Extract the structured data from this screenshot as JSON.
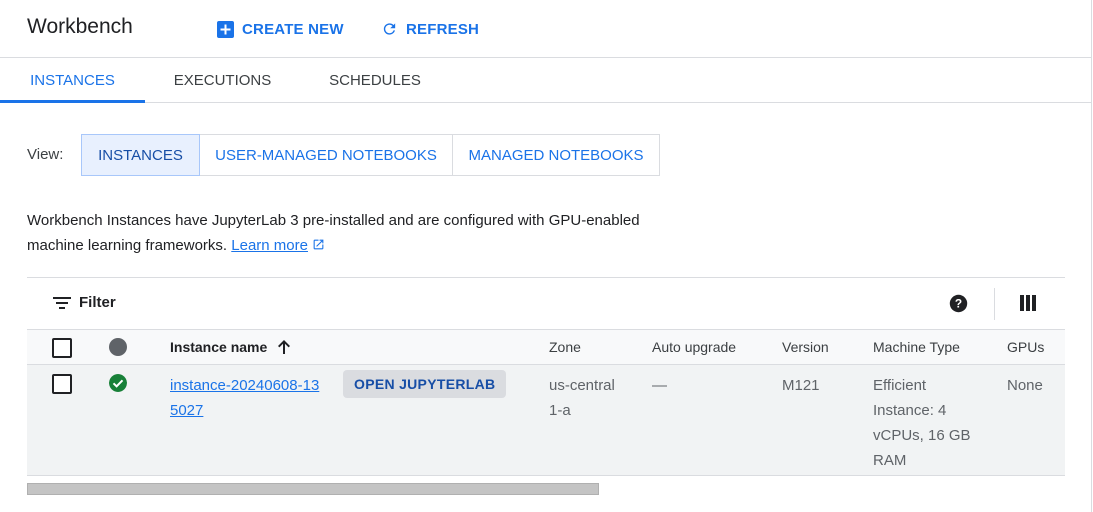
{
  "header": {
    "title": "Workbench",
    "create_label": "CREATE NEW",
    "refresh_label": "REFRESH"
  },
  "tabs": [
    {
      "label": "INSTANCES",
      "active": true
    },
    {
      "label": "EXECUTIONS",
      "active": false
    },
    {
      "label": "SCHEDULES",
      "active": false
    }
  ],
  "view": {
    "label": "View:",
    "options": [
      {
        "label": "INSTANCES",
        "selected": true
      },
      {
        "label": "USER-MANAGED NOTEBOOKS",
        "selected": false
      },
      {
        "label": "MANAGED NOTEBOOKS",
        "selected": false
      }
    ]
  },
  "description": {
    "text": "Workbench Instances have JupyterLab 3 pre-installed and are configured with GPU-enabled machine learning frameworks.",
    "link": "Learn more"
  },
  "toolbar": {
    "filter_label": "Filter",
    "icons": [
      "filter-icon",
      "help-icon",
      "column-display-icon"
    ]
  },
  "table": {
    "columns": {
      "name": "Instance name",
      "zone": "Zone",
      "auto_upgrade": "Auto upgrade",
      "version": "Version",
      "machine_type": "Machine Type",
      "gpus": "GPUs"
    },
    "rows": [
      {
        "name": "instance-20240608-135027",
        "action": "OPEN JUPYTERLAB",
        "zone": "us-central1-a",
        "auto_upgrade": "—",
        "version": "M121",
        "machine_type": "Efficient Instance: 4 vCPUs, 16 GB RAM",
        "gpus": "None",
        "status": "running"
      }
    ]
  },
  "colors": {
    "accent": "#1a73e8",
    "status_ok": "#188038",
    "status_header_dot": "#5f6368"
  }
}
